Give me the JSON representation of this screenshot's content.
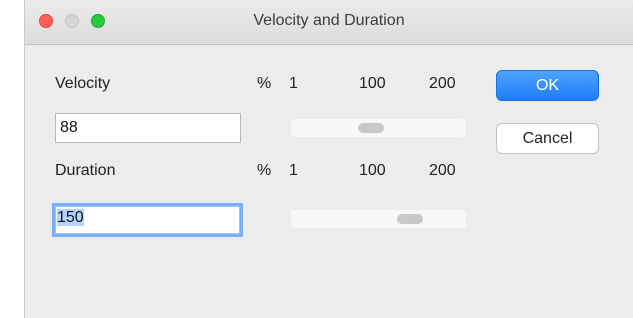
{
  "window": {
    "title": "Velocity and Duration",
    "controls": [
      "close",
      "minimize",
      "zoom"
    ]
  },
  "velocity": {
    "label": "Velocity",
    "unit": "%",
    "value": "88",
    "scale": [
      "1",
      "100",
      "200"
    ],
    "slider_value": 88,
    "slider_min": 1,
    "slider_max": 200
  },
  "duration": {
    "label": "Duration",
    "unit": "%",
    "value": "150",
    "scale": [
      "1",
      "100",
      "200"
    ],
    "slider_value": 150,
    "slider_min": 1,
    "slider_max": 200
  },
  "buttons": {
    "ok": "OK",
    "cancel": "Cancel"
  },
  "colors": {
    "accent": "#1e7ef7",
    "close": "#fe5f57",
    "zoom": "#28c840",
    "focus": "#7aaef5"
  }
}
